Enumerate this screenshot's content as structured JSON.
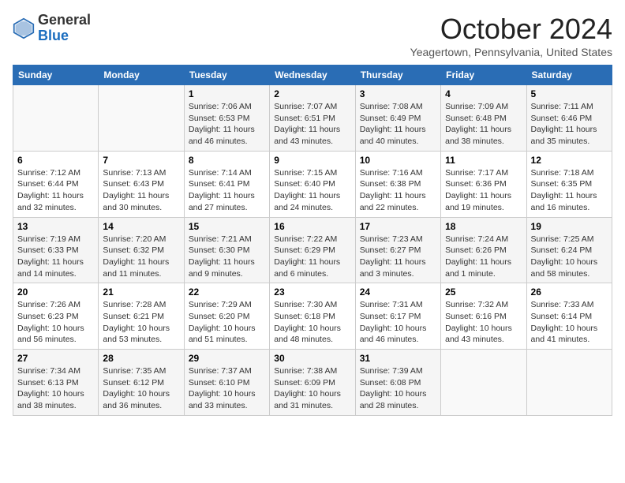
{
  "header": {
    "logo_line1": "General",
    "logo_line2": "Blue",
    "title": "October 2024",
    "subtitle": "Yeagertown, Pennsylvania, United States"
  },
  "weekdays": [
    "Sunday",
    "Monday",
    "Tuesday",
    "Wednesday",
    "Thursday",
    "Friday",
    "Saturday"
  ],
  "weeks": [
    [
      {
        "day": "",
        "info": ""
      },
      {
        "day": "",
        "info": ""
      },
      {
        "day": "1",
        "info": "Sunrise: 7:06 AM\nSunset: 6:53 PM\nDaylight: 11 hours and 46 minutes."
      },
      {
        "day": "2",
        "info": "Sunrise: 7:07 AM\nSunset: 6:51 PM\nDaylight: 11 hours and 43 minutes."
      },
      {
        "day": "3",
        "info": "Sunrise: 7:08 AM\nSunset: 6:49 PM\nDaylight: 11 hours and 40 minutes."
      },
      {
        "day": "4",
        "info": "Sunrise: 7:09 AM\nSunset: 6:48 PM\nDaylight: 11 hours and 38 minutes."
      },
      {
        "day": "5",
        "info": "Sunrise: 7:11 AM\nSunset: 6:46 PM\nDaylight: 11 hours and 35 minutes."
      }
    ],
    [
      {
        "day": "6",
        "info": "Sunrise: 7:12 AM\nSunset: 6:44 PM\nDaylight: 11 hours and 32 minutes."
      },
      {
        "day": "7",
        "info": "Sunrise: 7:13 AM\nSunset: 6:43 PM\nDaylight: 11 hours and 30 minutes."
      },
      {
        "day": "8",
        "info": "Sunrise: 7:14 AM\nSunset: 6:41 PM\nDaylight: 11 hours and 27 minutes."
      },
      {
        "day": "9",
        "info": "Sunrise: 7:15 AM\nSunset: 6:40 PM\nDaylight: 11 hours and 24 minutes."
      },
      {
        "day": "10",
        "info": "Sunrise: 7:16 AM\nSunset: 6:38 PM\nDaylight: 11 hours and 22 minutes."
      },
      {
        "day": "11",
        "info": "Sunrise: 7:17 AM\nSunset: 6:36 PM\nDaylight: 11 hours and 19 minutes."
      },
      {
        "day": "12",
        "info": "Sunrise: 7:18 AM\nSunset: 6:35 PM\nDaylight: 11 hours and 16 minutes."
      }
    ],
    [
      {
        "day": "13",
        "info": "Sunrise: 7:19 AM\nSunset: 6:33 PM\nDaylight: 11 hours and 14 minutes."
      },
      {
        "day": "14",
        "info": "Sunrise: 7:20 AM\nSunset: 6:32 PM\nDaylight: 11 hours and 11 minutes."
      },
      {
        "day": "15",
        "info": "Sunrise: 7:21 AM\nSunset: 6:30 PM\nDaylight: 11 hours and 9 minutes."
      },
      {
        "day": "16",
        "info": "Sunrise: 7:22 AM\nSunset: 6:29 PM\nDaylight: 11 hours and 6 minutes."
      },
      {
        "day": "17",
        "info": "Sunrise: 7:23 AM\nSunset: 6:27 PM\nDaylight: 11 hours and 3 minutes."
      },
      {
        "day": "18",
        "info": "Sunrise: 7:24 AM\nSunset: 6:26 PM\nDaylight: 11 hours and 1 minute."
      },
      {
        "day": "19",
        "info": "Sunrise: 7:25 AM\nSunset: 6:24 PM\nDaylight: 10 hours and 58 minutes."
      }
    ],
    [
      {
        "day": "20",
        "info": "Sunrise: 7:26 AM\nSunset: 6:23 PM\nDaylight: 10 hours and 56 minutes."
      },
      {
        "day": "21",
        "info": "Sunrise: 7:28 AM\nSunset: 6:21 PM\nDaylight: 10 hours and 53 minutes."
      },
      {
        "day": "22",
        "info": "Sunrise: 7:29 AM\nSunset: 6:20 PM\nDaylight: 10 hours and 51 minutes."
      },
      {
        "day": "23",
        "info": "Sunrise: 7:30 AM\nSunset: 6:18 PM\nDaylight: 10 hours and 48 minutes."
      },
      {
        "day": "24",
        "info": "Sunrise: 7:31 AM\nSunset: 6:17 PM\nDaylight: 10 hours and 46 minutes."
      },
      {
        "day": "25",
        "info": "Sunrise: 7:32 AM\nSunset: 6:16 PM\nDaylight: 10 hours and 43 minutes."
      },
      {
        "day": "26",
        "info": "Sunrise: 7:33 AM\nSunset: 6:14 PM\nDaylight: 10 hours and 41 minutes."
      }
    ],
    [
      {
        "day": "27",
        "info": "Sunrise: 7:34 AM\nSunset: 6:13 PM\nDaylight: 10 hours and 38 minutes."
      },
      {
        "day": "28",
        "info": "Sunrise: 7:35 AM\nSunset: 6:12 PM\nDaylight: 10 hours and 36 minutes."
      },
      {
        "day": "29",
        "info": "Sunrise: 7:37 AM\nSunset: 6:10 PM\nDaylight: 10 hours and 33 minutes."
      },
      {
        "day": "30",
        "info": "Sunrise: 7:38 AM\nSunset: 6:09 PM\nDaylight: 10 hours and 31 minutes."
      },
      {
        "day": "31",
        "info": "Sunrise: 7:39 AM\nSunset: 6:08 PM\nDaylight: 10 hours and 28 minutes."
      },
      {
        "day": "",
        "info": ""
      },
      {
        "day": "",
        "info": ""
      }
    ]
  ]
}
